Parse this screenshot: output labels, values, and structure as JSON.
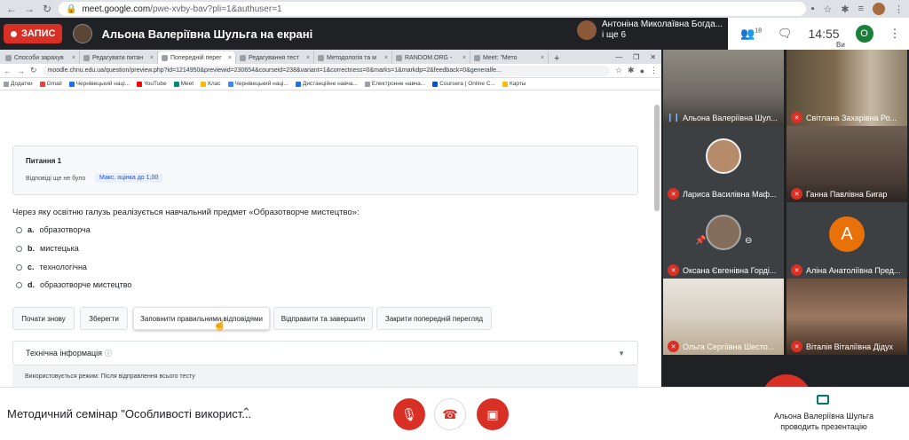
{
  "outer_browser": {
    "url_host": "meet.google.com",
    "url_path": "/pwe-xvby-bav?pli=1&authuser=1"
  },
  "meet_header": {
    "rec_label": "ЗАПИС",
    "presenting_title": "Альона Валеріївна Шульга на екрані",
    "speaker_name": "Антоніна Миколаївна Богда...",
    "speaker_more": "і ще 6",
    "people_count": "18",
    "time": "14:55",
    "you_initial": "О",
    "you_label": "Ви"
  },
  "inner_browser": {
    "tabs": [
      {
        "label": "Способи зарахув"
      },
      {
        "label": "Редагувати питан"
      },
      {
        "label": "Попередній перег"
      },
      {
        "label": "Редагування тест"
      },
      {
        "label": "Методологія та м"
      },
      {
        "label": "RANDOM.ORG - "
      },
      {
        "label": "Meet: \"Мето"
      }
    ],
    "url": "moodle.chnu.edu.ua/question/preview.php?id=1214950&previewid=230654&courseid=238&variant=1&correctness=0&marks=1&markdp=2&feedback=0&generalfe...",
    "bookmarks": [
      "Додатки",
      "Gmail",
      "Чернівецький наці...",
      "YouTube",
      "Meet",
      "Клас",
      "Чернівецький наці...",
      "Дистанційне навча...",
      "Електронне навча...",
      "Coursera | Online C...",
      "Карты"
    ]
  },
  "question": {
    "number_label": "Питання 1",
    "status": "Відповіді ще не було",
    "max_mark": "Макс. оцінка до 1,00",
    "text": "Через яку освітню галузь реалізується навчальний предмет «Образотворче мистецтво»:",
    "options": [
      {
        "letter": "a.",
        "text": "образотворча"
      },
      {
        "letter": "b.",
        "text": "мистецька"
      },
      {
        "letter": "c.",
        "text": "технологічна"
      },
      {
        "letter": "d.",
        "text": "образотворче мистецтво"
      }
    ]
  },
  "buttons": {
    "restart": "Почати знову",
    "save": "Зберегти",
    "fill_correct": "Заповнити правильними відповідями",
    "submit": "Відправити та завершити",
    "close_preview": "Закрити попередній перегляд"
  },
  "tech_info": {
    "label": "Технічна інформація",
    "mode_text": "Використовується режим: Після відправлення всього тесту"
  },
  "participants": [
    {
      "name": "Альона Валеріївна Шул...",
      "mic": "on"
    },
    {
      "name": "Світлана Захарівна Ро...",
      "mic": "off"
    },
    {
      "name": "Лариса Василівна Маф...",
      "mic": "off"
    },
    {
      "name": "Ганна Павлівна Бигар",
      "mic": "off"
    },
    {
      "name": "Оксана Євгенівна Горді...",
      "mic": "off"
    },
    {
      "name": "Аліна Анатоліївна Пред...",
      "mic": "off",
      "initial": "А"
    },
    {
      "name": "Ольга Сергіївна Шесто...",
      "mic": "off"
    },
    {
      "name": "Віталія Віталіївна Дідух",
      "mic": "off"
    }
  ],
  "bottom_bar": {
    "meeting_title": "Методичний семінар \"Особливості використ...",
    "presenter_line1": "Альона Валеріївна Шульга",
    "presenter_line2": "проводить презентацію"
  },
  "colors": {
    "rec_red": "#d93025",
    "meet_dark": "#202124",
    "present_teal": "#00796b"
  }
}
